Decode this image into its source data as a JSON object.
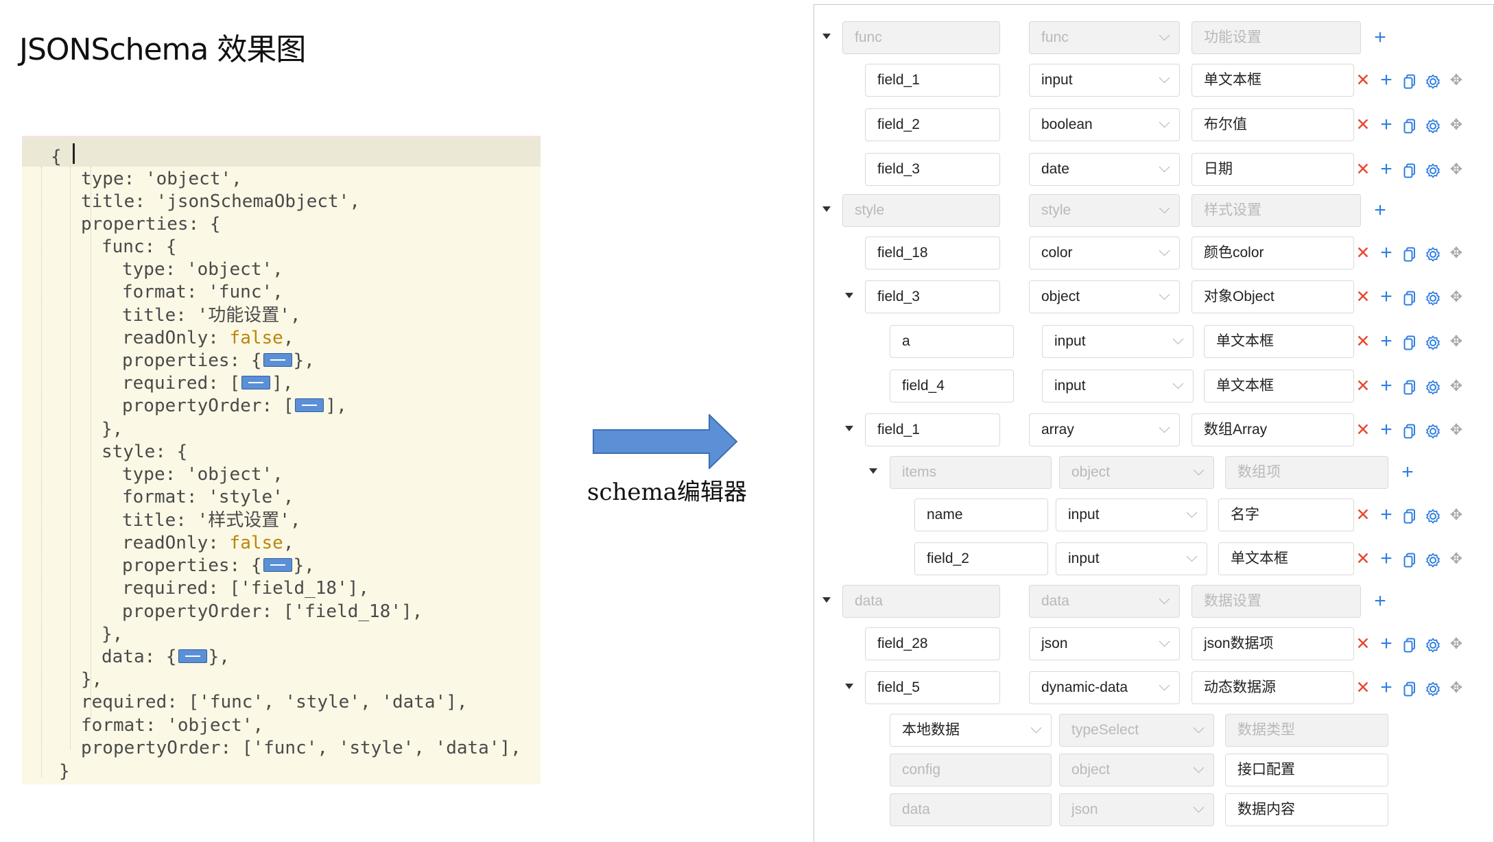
{
  "page": {
    "title": "JSONSchema 效果图"
  },
  "code": {
    "lines": [
      {
        "i": 0,
        "text": "{"
      },
      {
        "i": 1,
        "text": "type: 'object',"
      },
      {
        "i": 1,
        "text": "title: 'jsonSchemaObject',"
      },
      {
        "i": 1,
        "text": "properties: {"
      },
      {
        "i": 2,
        "text": "func: {"
      },
      {
        "i": 3,
        "text": "type: 'object',"
      },
      {
        "i": 3,
        "text": "format: 'func',"
      },
      {
        "i": 3,
        "text": "title: '功能设置',"
      },
      {
        "i": 3,
        "pre": "readOnly: ",
        "bool": "false",
        "post": ","
      },
      {
        "i": 3,
        "pre": "properties: {",
        "fold": true,
        "post": "},"
      },
      {
        "i": 3,
        "pre": "required: [",
        "fold": true,
        "post": "],"
      },
      {
        "i": 3,
        "pre": "propertyOrder: [",
        "fold": true,
        "post": "],"
      },
      {
        "i": 2,
        "text": "},"
      },
      {
        "i": 2,
        "text": "style: {"
      },
      {
        "i": 3,
        "text": "type: 'object',"
      },
      {
        "i": 3,
        "text": "format: 'style',"
      },
      {
        "i": 3,
        "text": "title: '样式设置',"
      },
      {
        "i": 3,
        "pre": "readOnly: ",
        "bool": "false",
        "post": ","
      },
      {
        "i": 3,
        "pre": "properties: {",
        "fold": true,
        "post": "},"
      },
      {
        "i": 3,
        "text": "required: ['field_18'],"
      },
      {
        "i": 3,
        "text": "propertyOrder: ['field_18'],"
      },
      {
        "i": 2,
        "text": "},"
      },
      {
        "i": 2,
        "pre": "data: {",
        "fold": true,
        "post": "},"
      },
      {
        "i": 1,
        "text": "},"
      },
      {
        "i": 1,
        "text": "required: ['func', 'style', 'data'],"
      },
      {
        "i": 1,
        "text": "format: 'object',"
      },
      {
        "i": 1,
        "text": "propertyOrder: ['func', 'style', 'data'],"
      },
      {
        "i": 0,
        "text": "}"
      }
    ]
  },
  "arrow": {
    "label": "schema编辑器"
  },
  "editor": {
    "rows": [
      {
        "level": 0,
        "toggle": true,
        "group": true,
        "key": "func",
        "type": "func",
        "title": "功能设置"
      },
      {
        "level": 1,
        "key": "field_1",
        "type": "input",
        "title": "单文本框"
      },
      {
        "level": 1,
        "key": "field_2",
        "type": "boolean",
        "title": "布尔值"
      },
      {
        "level": 1,
        "key": "field_3",
        "type": "date",
        "title": "日期"
      },
      {
        "level": 0,
        "toggle": true,
        "group": true,
        "key": "style",
        "type": "style",
        "title": "样式设置"
      },
      {
        "level": 1,
        "key": "field_18",
        "type": "color",
        "title": "颜色color"
      },
      {
        "level": 1,
        "toggle": true,
        "key": "field_3",
        "type": "object",
        "title": "对象Object"
      },
      {
        "level": 2,
        "key": "a",
        "type": "input",
        "title": "单文本框"
      },
      {
        "level": 2,
        "key": "field_4",
        "type": "input",
        "title": "单文本框"
      },
      {
        "level": 1,
        "toggle": true,
        "key": "field_1",
        "type": "array",
        "title": "数组Array"
      },
      {
        "level": 2,
        "toggle": true,
        "group": true,
        "key": "items",
        "type": "object",
        "title": "数组项"
      },
      {
        "level": 3,
        "key": "name",
        "type": "input",
        "title": "名字"
      },
      {
        "level": 3,
        "key": "field_2",
        "type": "input",
        "title": "单文本框"
      },
      {
        "level": 0,
        "toggle": true,
        "group": true,
        "key": "data",
        "type": "data",
        "title": "数据设置"
      },
      {
        "level": 1,
        "key": "field_28",
        "type": "json",
        "title": "json数据项"
      },
      {
        "level": 1,
        "toggle": true,
        "key": "field_5",
        "type": "dynamic-data",
        "title": "动态数据源"
      },
      {
        "level": 2,
        "special": "local",
        "key": "本地数据",
        "type": "typeSelect",
        "title": "数据类型"
      },
      {
        "level": 2,
        "special": "sub",
        "key": "config",
        "type": "object",
        "title": "接口配置"
      },
      {
        "level": 2,
        "special": "sub",
        "key": "data",
        "type": "json",
        "title": "数据内容"
      }
    ],
    "icons": {
      "delete": "close-icon",
      "add": "plus-icon",
      "copy": "copy-icon",
      "settings": "gear-icon",
      "move": "drag-move-icon"
    },
    "colors": {
      "delete": "#e8472d",
      "add": "#2f7fe0",
      "disabled_bg": "#f2f2f2"
    }
  }
}
